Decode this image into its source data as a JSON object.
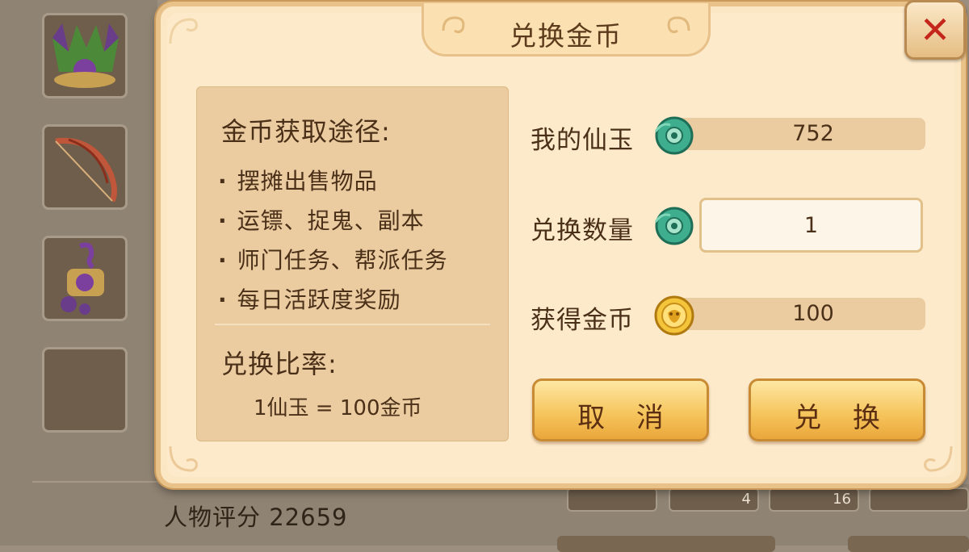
{
  "background": {
    "score_text": "人物评分 22659",
    "item_counts": [
      "4",
      "16"
    ]
  },
  "dialog": {
    "title": "兑换金币",
    "close_label": "✕",
    "info": {
      "title": "金币获取途径:",
      "items": [
        "摆摊出售物品",
        "运镖、捉鬼、副本",
        "师门任务、帮派任务",
        "每日活跃度奖励"
      ],
      "rate_title": "兑换比率:",
      "rate_value": "1仙玉 = 100金币"
    },
    "my_jade": {
      "label": "我的仙玉",
      "value": "752",
      "icon": "jade-icon"
    },
    "exchange_qty": {
      "label": "兑换数量",
      "value": "1",
      "icon": "jade-icon"
    },
    "gained_gold": {
      "label": "获得金币",
      "value": "100",
      "icon": "gold-coin-icon"
    },
    "cancel_label": "取 消",
    "confirm_label": "兑 换"
  },
  "colors": {
    "panel_bg": "#fdeacb",
    "info_bg": "#ebcba0",
    "text": "#4a3018",
    "button": "#f6c65e",
    "close_x": "#c5261b"
  }
}
